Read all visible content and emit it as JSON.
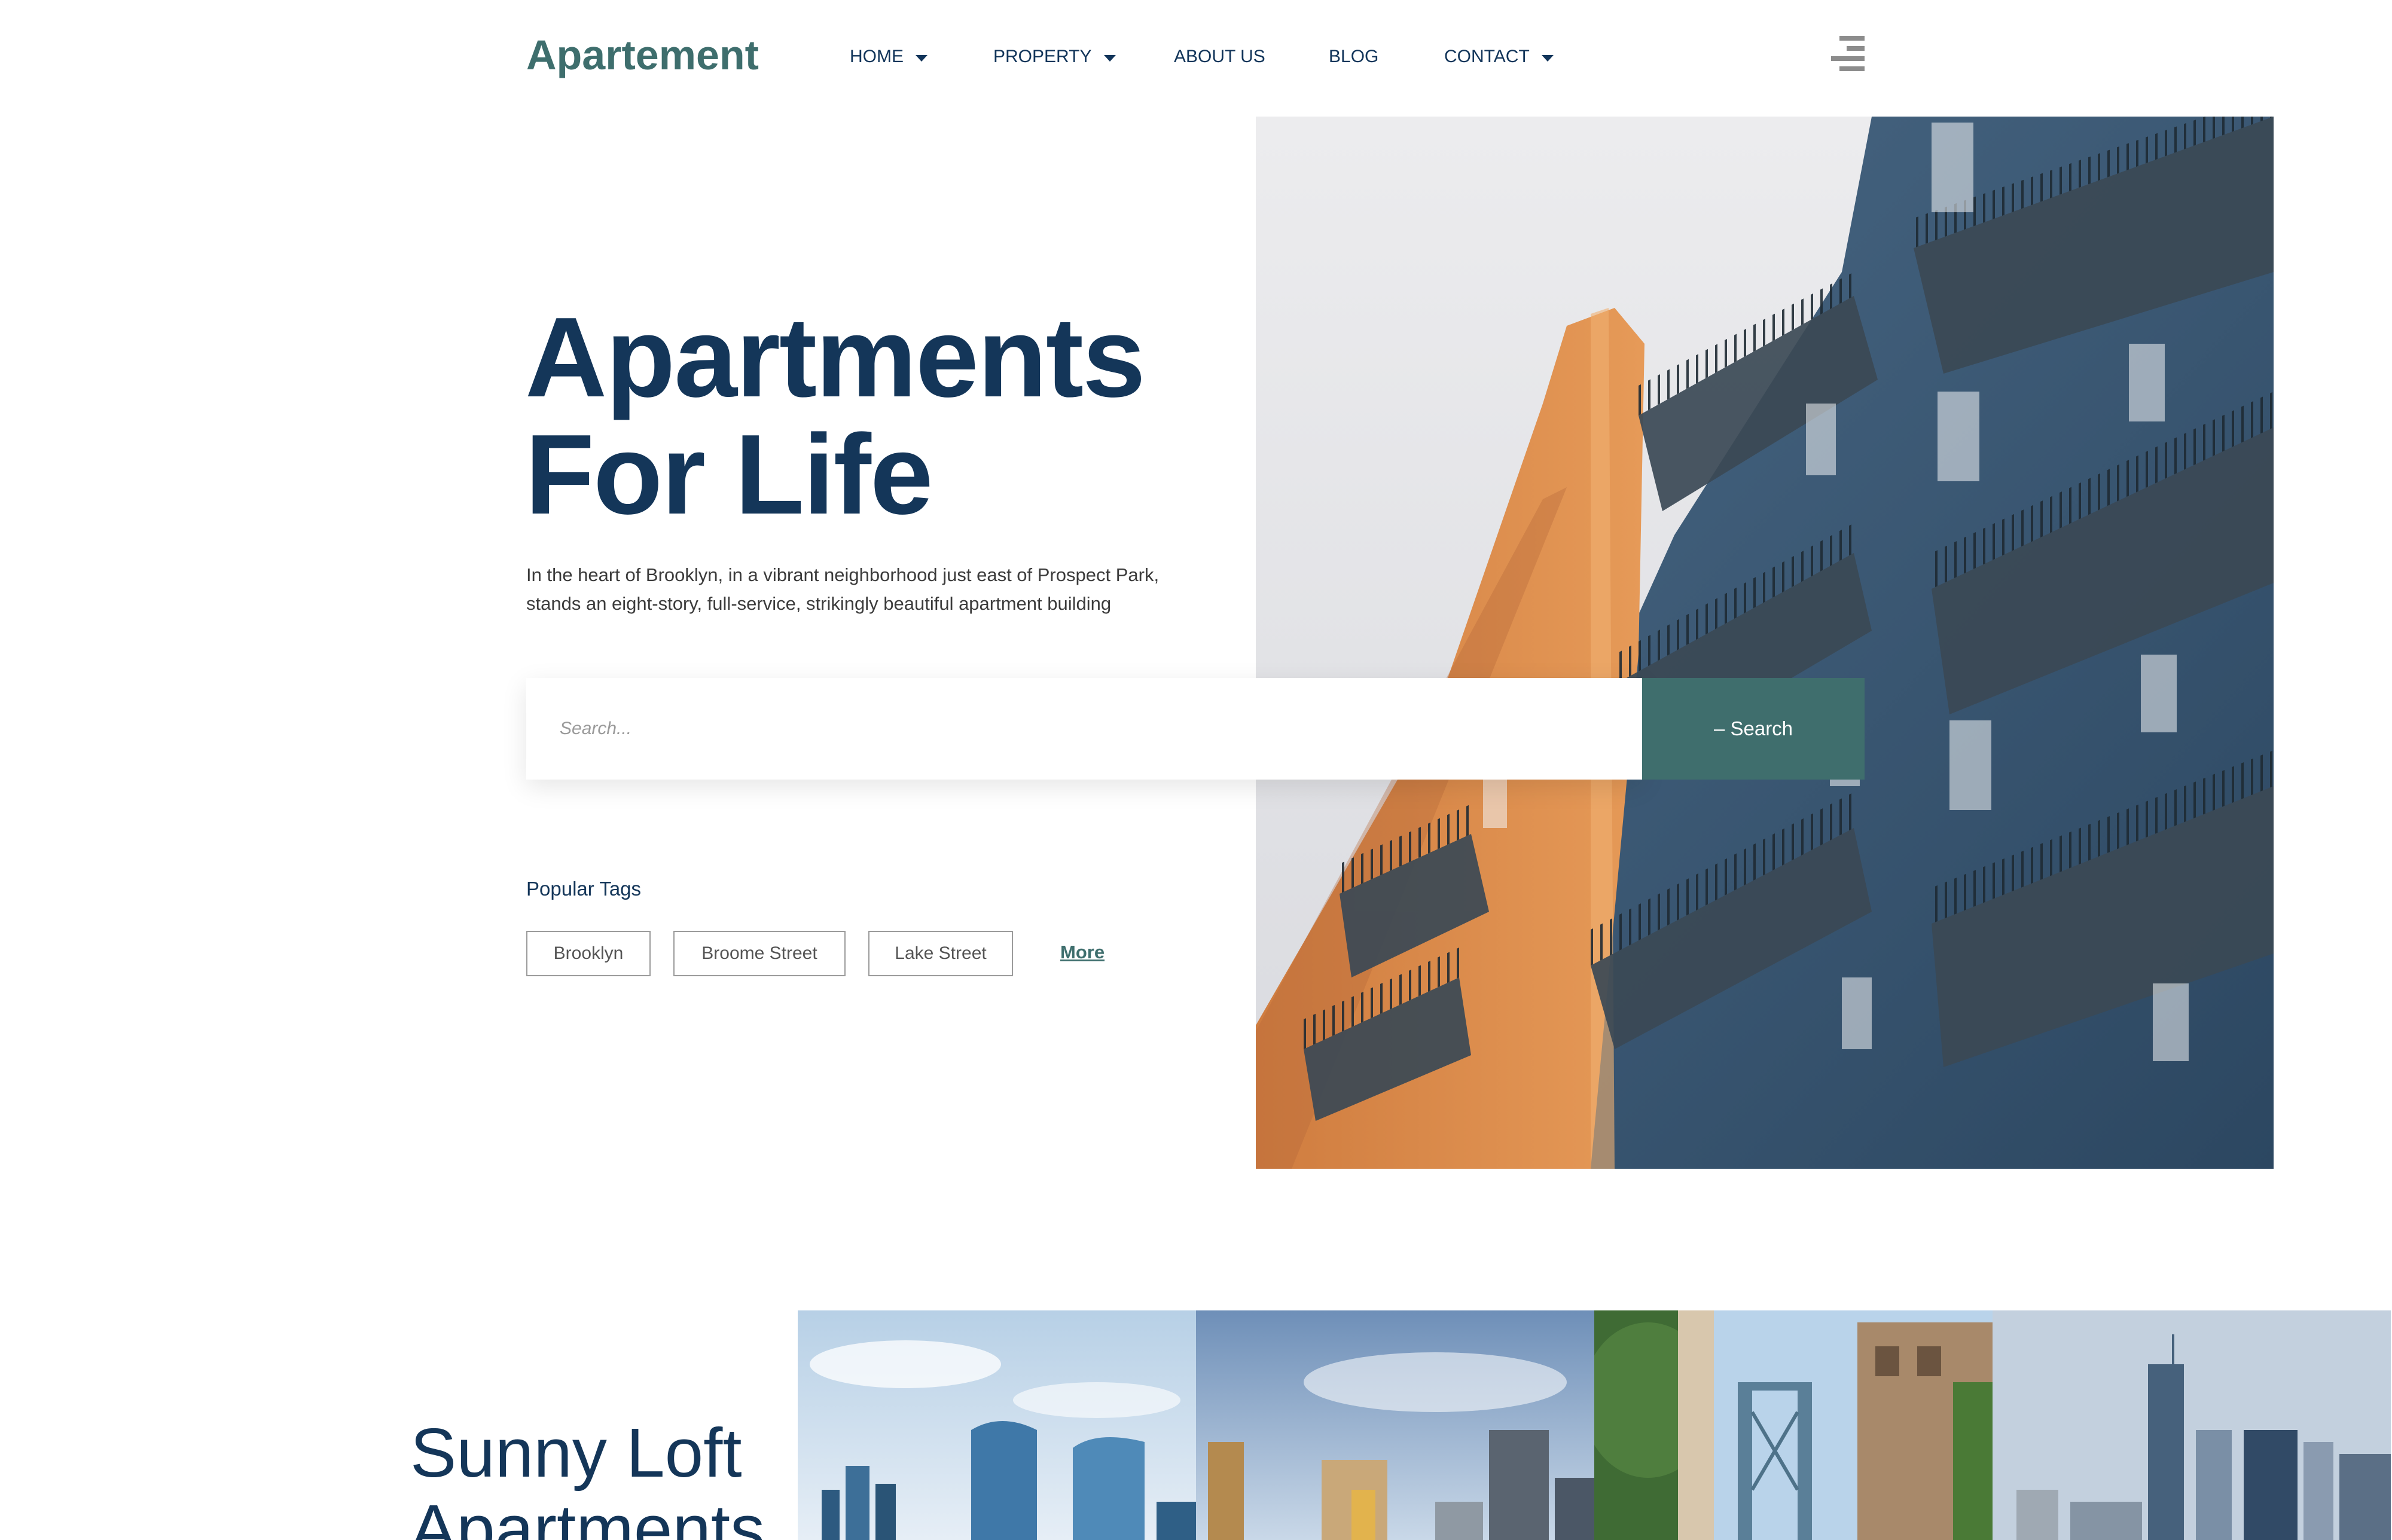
{
  "header": {
    "logo": "Apartement",
    "nav": [
      {
        "label": "HOME",
        "has_dropdown": true
      },
      {
        "label": "PROPERTY",
        "has_dropdown": true
      },
      {
        "label": "ABOUT US",
        "has_dropdown": false
      },
      {
        "label": "BLOG",
        "has_dropdown": false
      },
      {
        "label": "CONTACT",
        "has_dropdown": true
      }
    ],
    "menu_icon": "hamburger-menu-icon"
  },
  "hero": {
    "title_line1": "Apartments",
    "title_line2": "For Life",
    "description": "In the heart of Brooklyn, in a vibrant neighborhood just east of Prospect Park, stands an eight-story, full-service, strikingly beautiful apartment building",
    "image": "apartment-building-photo"
  },
  "search": {
    "placeholder": "Search...",
    "button_label": "– Search"
  },
  "tags": {
    "heading": "Popular Tags",
    "items": [
      "Brooklyn",
      "Broome Street",
      "Lake Street"
    ],
    "more_label": "More"
  },
  "section2": {
    "title": "Sunny Loft Apartments",
    "gallery": [
      "city-skyline-photo-1",
      "city-skyline-photo-2",
      "bridge-photo",
      "city-skyline-photo-3"
    ]
  },
  "colors": {
    "brand": "#3e6e6d",
    "navy": "#143659",
    "building_blue": "#3a5a78",
    "building_orange": "#e08d4a"
  }
}
